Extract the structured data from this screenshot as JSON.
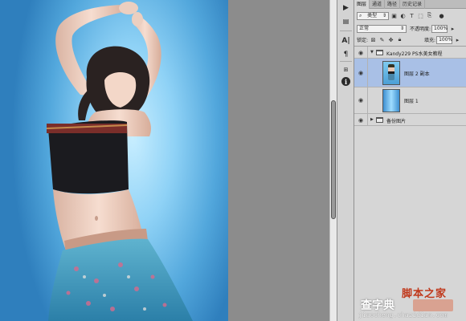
{
  "panel": {
    "tabs": [
      "图层",
      "通道",
      "路径",
      "历史记录"
    ],
    "filter_kind": "类型",
    "blend_mode": "正常",
    "opacity_label": "不透明度:",
    "opacity_value": "100%",
    "lock_label": "锁定:",
    "fill_label": "填充:",
    "fill_value": "100%"
  },
  "layers": [
    {
      "name": "Kandy229  PS水美女教程",
      "type": "group",
      "expanded": true
    },
    {
      "name": "图层 2 副本",
      "type": "photo",
      "selected": true
    },
    {
      "name": "图层 1",
      "type": "gradient",
      "selected": false
    },
    {
      "name": "备份图片",
      "type": "group",
      "expanded": false
    }
  ],
  "watermark": {
    "brand": "脚本之家",
    "site": "查字典",
    "url": "jiaocheng.chazidian.com"
  },
  "colors": {
    "selection": "#a9c0e6",
    "panel": "#d6d6d6",
    "canvas_blue": "#52a7dc"
  },
  "icons": [
    "play-icon",
    "history-icon",
    "type-icon",
    "paragraph-icon",
    "grid-icon",
    "info-icon",
    "hand-icon",
    "eye-icon",
    "folder-icon",
    "lock-icon"
  ]
}
